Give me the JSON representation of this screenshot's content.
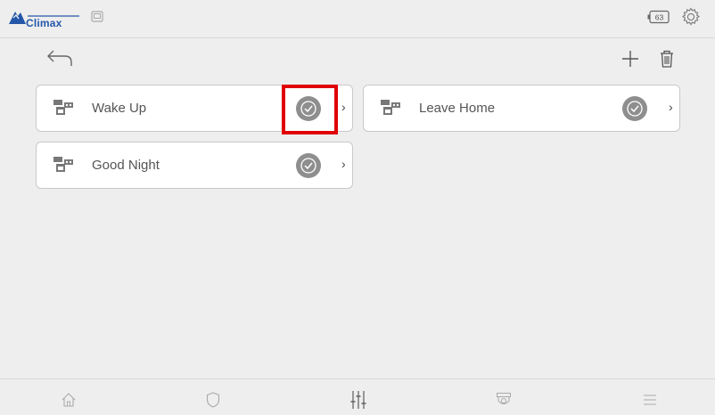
{
  "header": {
    "logo_text": "Climax",
    "battery_value": "63"
  },
  "scenes": [
    {
      "label": "Wake Up"
    },
    {
      "label": "Leave Home"
    },
    {
      "label": "Good Night"
    }
  ],
  "bottom_nav": [
    "home-icon",
    "shield-icon",
    "sliders-icon",
    "camera-icon",
    "list-icon"
  ],
  "colors": {
    "background": "#eeeeee",
    "card": "#ffffff",
    "check_button": "#8e8e8e",
    "highlight": "#e00000",
    "brand_blue": "#2457a8"
  }
}
